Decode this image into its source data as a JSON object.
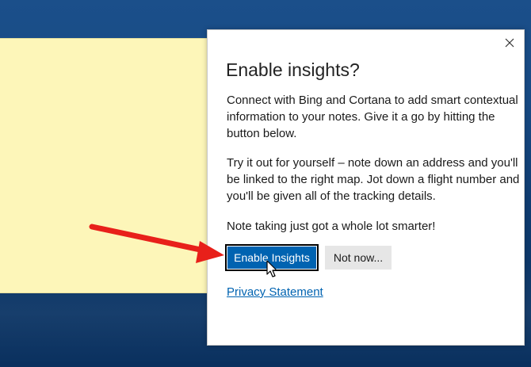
{
  "dialog": {
    "title": "Enable insights?",
    "paragraphs": [
      "Connect with Bing and Cortana to add smart contextual information to your notes. Give it a go by hitting the button below.",
      "Try it out for yourself – note down an address and you'll be linked to the right map. Jot down a flight number and you'll be given all of the tracking details.",
      "Note taking just got a whole lot smarter!"
    ],
    "enable_label": "Enable Insights",
    "not_now_label": "Not now...",
    "privacy_label": "Privacy Statement",
    "close_icon": "close-icon"
  },
  "colors": {
    "accent": "#0063b1",
    "annotation_arrow": "#e8201a",
    "sticky_note": "#fdf6b9",
    "desktop": "#174a84"
  },
  "icons": {
    "close": "close-icon",
    "cursor": "mouse-pointer-icon",
    "arrow": "annotation-arrow-icon"
  }
}
